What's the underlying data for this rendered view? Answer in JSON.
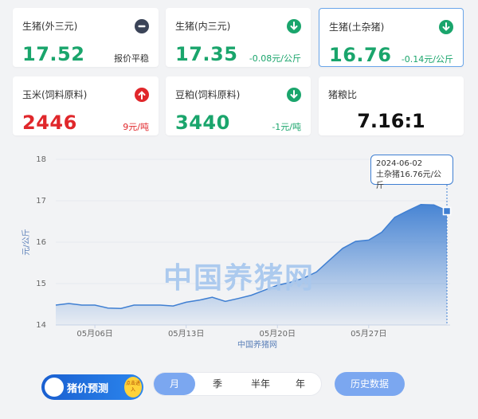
{
  "cards": [
    {
      "label": "生猪(外三元)",
      "value": "17.52",
      "change": "报价平稳",
      "icon": "minus-circle-icon"
    },
    {
      "label": "生猪(内三元)",
      "value": "17.35",
      "change": "-0.08元/公斤",
      "icon": "down-arrow-circle-icon"
    },
    {
      "label": "生猪(土杂猪)",
      "value": "16.76",
      "change": "-0.14元/公斤",
      "icon": "down-arrow-circle-icon"
    },
    {
      "label": "玉米(饲料原料)",
      "value": "2446",
      "change": "9元/吨",
      "icon": "up-arrow-circle-icon"
    },
    {
      "label": "豆粕(饲料原料)",
      "value": "3440",
      "change": "-1元/吨",
      "icon": "down-arrow-circle-icon"
    },
    {
      "label": "猪粮比",
      "value": "7.16:1"
    }
  ],
  "colors": {
    "up": "#e0272b",
    "down": "#1aa56c",
    "flat": "#3b4458",
    "line": "#3f7fd2"
  },
  "tooltip": {
    "date": "2024-06-02",
    "text": "土杂猪16.76元/公斤"
  },
  "watermark": "中国养猪网",
  "chart_data": {
    "type": "area",
    "ylabel": "元/公斤",
    "xlabel": "中国养猪网",
    "ylim": [
      14,
      18
    ],
    "yticks": [
      "14",
      "15",
      "16",
      "17",
      "18"
    ],
    "xticks": [
      "05月06日",
      "05月13日",
      "05月20日",
      "05月27日"
    ],
    "series": [
      {
        "x": [
          "2024-05-03",
          "2024-05-04",
          "2024-05-05",
          "2024-05-06",
          "2024-05-07",
          "2024-05-08",
          "2024-05-09",
          "2024-05-10",
          "2024-05-11",
          "2024-05-12",
          "2024-05-13",
          "2024-05-14",
          "2024-05-15",
          "2024-05-16",
          "2024-05-17",
          "2024-05-18",
          "2024-05-19",
          "2024-05-20",
          "2024-05-21",
          "2024-05-22",
          "2024-05-23",
          "2024-05-24",
          "2024-05-25",
          "2024-05-26",
          "2024-05-27",
          "2024-05-28",
          "2024-05-29",
          "2024-05-30",
          "2024-05-31",
          "2024-06-01",
          "2024-06-02"
        ],
        "values": [
          14.48,
          14.52,
          14.48,
          14.48,
          14.41,
          14.4,
          14.48,
          14.48,
          14.48,
          14.46,
          14.55,
          14.6,
          14.67,
          14.57,
          14.64,
          14.72,
          14.84,
          14.96,
          15.03,
          15.13,
          15.28,
          15.57,
          15.85,
          16.02,
          16.05,
          16.24,
          16.6,
          16.76,
          16.91,
          16.9,
          16.76
        ]
      }
    ],
    "grid": true
  },
  "bottom": {
    "logo_text": "猪价预测",
    "badge_text": "点击进入",
    "tabs": [
      "月",
      "季",
      "半年",
      "年"
    ],
    "active_tab": "月",
    "history": "历史数据"
  }
}
